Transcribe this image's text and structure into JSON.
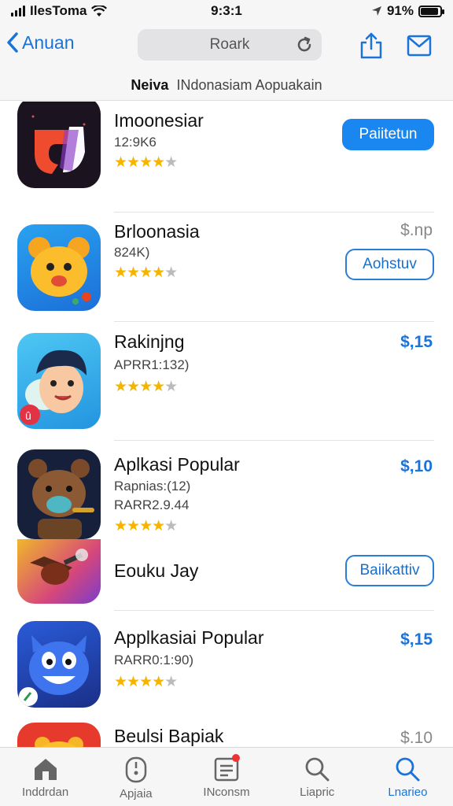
{
  "status": {
    "carrier": "IlesToma",
    "time": "9:3:1",
    "battery": "91%",
    "battery_level": 0.91
  },
  "nav": {
    "back_label": "Anuan",
    "search_text": "Roark"
  },
  "subtitle": {
    "primary": "Neiva",
    "secondary": "INdonasiam Aopuakain"
  },
  "apps": [
    {
      "name": "Imoonesiar",
      "meta": [
        "12:9K6"
      ],
      "rating": 4,
      "action": "Paiitetun",
      "action_style": "solid",
      "price": ""
    },
    {
      "name": "Brloonasia",
      "meta": [
        "824K)"
      ],
      "rating": 4,
      "action": "Aohstuv",
      "action_style": "outline",
      "price": "$.np"
    },
    {
      "name": "Rakinjng",
      "meta": [
        "APRR1:132)"
      ],
      "rating": 4,
      "action": "",
      "action_style": "",
      "price": "$,15"
    },
    {
      "name": "Aplkasi Popular",
      "meta": [
        "Rapnias:(12)",
        "RARR2.9.44"
      ],
      "rating": 4,
      "action": "",
      "action_style": "",
      "price": "$,10"
    },
    {
      "name": "Eouku Jay",
      "meta": [],
      "rating": 0,
      "action": "Baiikattiv",
      "action_style": "outline",
      "price": ""
    },
    {
      "name": "Applkasiai Popular",
      "meta": [
        "RARR0:1:90)"
      ],
      "rating": 4,
      "action": "",
      "action_style": "",
      "price": "$,15"
    },
    {
      "name": "Beulsi Bapiak",
      "meta": [],
      "rating": 0,
      "action": "",
      "action_style": "",
      "price": "$.10"
    }
  ],
  "tabs": [
    {
      "label": "Inddrdan",
      "icon": "home-icon"
    },
    {
      "label": "Apjaia",
      "icon": "game-controller-icon"
    },
    {
      "label": "INconsm",
      "icon": "updates-icon"
    },
    {
      "label": "Liapric",
      "icon": "search-icon"
    },
    {
      "label": "Lnarieo",
      "icon": "search-icon",
      "active": true
    }
  ],
  "colors": {
    "accent": "#1a73d9",
    "star": "#f4b400"
  }
}
